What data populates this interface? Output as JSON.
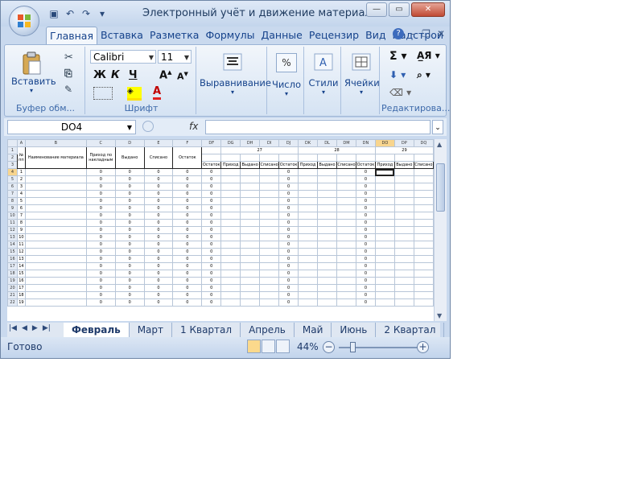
{
  "window": {
    "title": "Электронный учёт и движение материалла н...",
    "buttons": {
      "minimize": "—",
      "maximize": "▭",
      "close": "✕"
    }
  },
  "qat": [
    "save-icon",
    "undo-icon",
    "redo-icon",
    "customize-icon"
  ],
  "ribbon_tabs": [
    "Главная",
    "Вставка",
    "Разметка",
    "Формулы",
    "Данные",
    "Рецензир",
    "Вид",
    "Надстрой"
  ],
  "active_tab": "Главная",
  "ribbon": {
    "clipboard": {
      "paste_label": "Вставить",
      "group_label": "Буфер обм..."
    },
    "font": {
      "name": "Calibri",
      "size": "11",
      "bold": "Ж",
      "italic": "К",
      "underline": "Ч",
      "group_label": "Шрифт"
    },
    "alignment": {
      "label": "Выравнивание"
    },
    "number": {
      "label": "Число",
      "symbol": "%"
    },
    "styles": {
      "label": "Стили"
    },
    "cells": {
      "label": "Ячейки"
    },
    "editing": {
      "group_label": "Редактирова..."
    }
  },
  "formula_bar": {
    "name_box": "DO4",
    "fx": "fx",
    "content": ""
  },
  "sheet": {
    "col_headers_left": [
      "A",
      "B",
      "C",
      "D",
      "E",
      "F"
    ],
    "col_headers_right": [
      "DF",
      "DG",
      "DH",
      "DI",
      "DJ",
      "DK",
      "DL",
      "DM",
      "DN",
      "DO",
      "DP",
      "DQ"
    ],
    "selected_col": "DO",
    "selected_row": 4,
    "header_texts": {
      "num": "№ пп",
      "material": "Наименование материала",
      "income": "Приход по накладным",
      "issued": "Выдано",
      "written_off": "Списано",
      "balance": "Остаток"
    },
    "days": [
      "27",
      "28",
      "29"
    ],
    "sub_headers": [
      "Приход",
      "Выдано",
      "Списано",
      "Остаток"
    ],
    "row_labels": [
      "1",
      "2",
      "3",
      "4",
      "5",
      "6",
      "7",
      "8",
      "9",
      "10",
      "11",
      "12",
      "13",
      "14",
      "15",
      "16",
      "17",
      "18",
      "19",
      "20",
      "21",
      "22"
    ],
    "zero": "0"
  },
  "sheet_tabs": [
    "Февраль",
    "Март",
    "1 Квартал",
    "Апрель",
    "Май",
    "Июнь",
    "2 Квартал"
  ],
  "active_sheet": "Февраль",
  "status": {
    "ready": "Готово",
    "zoom": "44%",
    "zoom_fraction": 0.44
  }
}
